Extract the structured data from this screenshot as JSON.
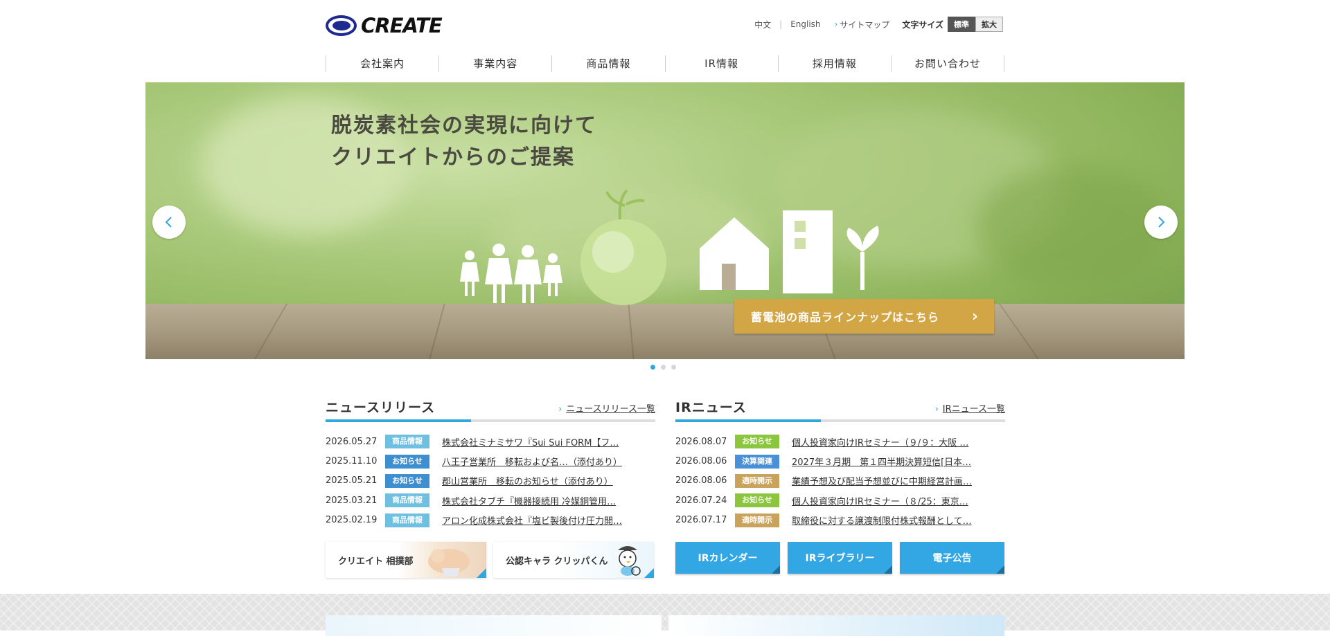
{
  "logo": {
    "text": "CREATE"
  },
  "utility": {
    "lang_zh": "中文",
    "lang_en": "English",
    "sitemap": "サイトマップ",
    "font_size_label": "文字サイズ",
    "font_standard": "標準",
    "font_large": "拡大"
  },
  "nav": {
    "items": [
      "会社案内",
      "事業内容",
      "商品情報",
      "IR情報",
      "採用情報",
      "お問い合わせ"
    ]
  },
  "hero": {
    "line1": "脱炭素社会の実現に向けて",
    "line2": "クリエイトからのご提案",
    "cta": "蓄電池の商品ラインナップはこちら",
    "slide_count": 3,
    "active_slide": 1
  },
  "news": {
    "title": "ニュースリリース",
    "more": "ニュースリリース一覧",
    "rows": [
      {
        "date": "2026.05.27",
        "tag": "商品情報",
        "tag_color": "#6fbfe0",
        "title": "株式会社ミナミサワ『Sui Sui FORM【フ…"
      },
      {
        "date": "2025.11.10",
        "tag": "お知らせ",
        "tag_color": "#3d8fd0",
        "title": "八王子営業所　移転および名…（添付あり）"
      },
      {
        "date": "2025.05.21",
        "tag": "お知らせ",
        "tag_color": "#3d8fd0",
        "title": "郡山営業所　移転のお知らせ（添付あり）"
      },
      {
        "date": "2025.03.21",
        "tag": "商品情報",
        "tag_color": "#6fbfe0",
        "title": "株式会社タブチ『機器接続用 冷媒銅管用…"
      },
      {
        "date": "2025.02.19",
        "tag": "商品情報",
        "tag_color": "#6fbfe0",
        "title": "アロン化成株式会社『塩ビ製後付け圧力開…"
      }
    ]
  },
  "ir": {
    "title": "IRニュース",
    "more": "IRニュース一覧",
    "rows": [
      {
        "date": "2026.08.07",
        "tag": "お知らせ",
        "tag_color": "#8cc63f",
        "title": "個人投資家向けIRセミナー（９/９：大阪 …"
      },
      {
        "date": "2026.08.06",
        "tag": "決算関連",
        "tag_color": "#4a90d9",
        "title": "2027年３月期　第１四半期決算短信[日本…"
      },
      {
        "date": "2026.08.06",
        "tag": "適時開示",
        "tag_color": "#c9a35c",
        "title": "業績予想及び配当予想並びに中期経営計画…"
      },
      {
        "date": "2026.07.24",
        "tag": "お知らせ",
        "tag_color": "#8cc63f",
        "title": "個人投資家向けIRセミナー（８/25：東京…"
      },
      {
        "date": "2026.07.17",
        "tag": "適時開示",
        "tag_color": "#c9a35c",
        "title": "取締役に対する譲渡制限付株式報酬として…"
      }
    ]
  },
  "banners": {
    "sumo": "クリエイト 相撲部",
    "chara": "公認キャラ クリッパくん"
  },
  "ir_buttons": [
    "IRカレンダー",
    "IRライブラリー",
    "電子公告"
  ]
}
